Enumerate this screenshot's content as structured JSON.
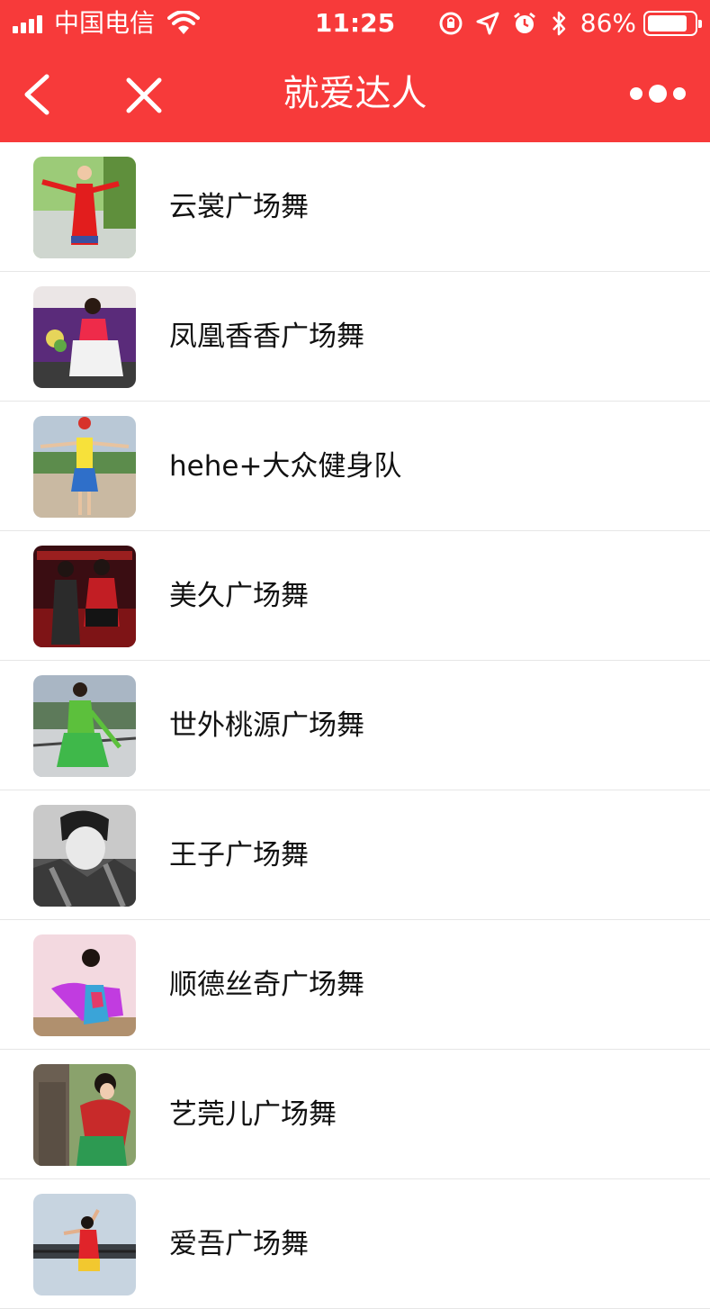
{
  "status_bar": {
    "carrier": "中国电信",
    "time": "11:25",
    "battery_percent": "86%",
    "battery_level": 0.86
  },
  "nav": {
    "title": "就爱达人",
    "back_icon": "chevron-left-icon",
    "close_icon": "close-icon",
    "more_icon": "more-dots-icon"
  },
  "colors": {
    "header_bg": "#f73a3a",
    "text": "#111111",
    "divider": "#e6e6e6"
  },
  "items": [
    {
      "name": "云裳广场舞"
    },
    {
      "name": "凤凰香香广场舞"
    },
    {
      "name": "hehe+大众健身队"
    },
    {
      "name": "美久广场舞"
    },
    {
      "name": "世外桃源广场舞"
    },
    {
      "name": "王子广场舞"
    },
    {
      "name": "顺德丝奇广场舞"
    },
    {
      "name": "艺莞儿广场舞"
    },
    {
      "name": "爱吾广场舞"
    }
  ]
}
